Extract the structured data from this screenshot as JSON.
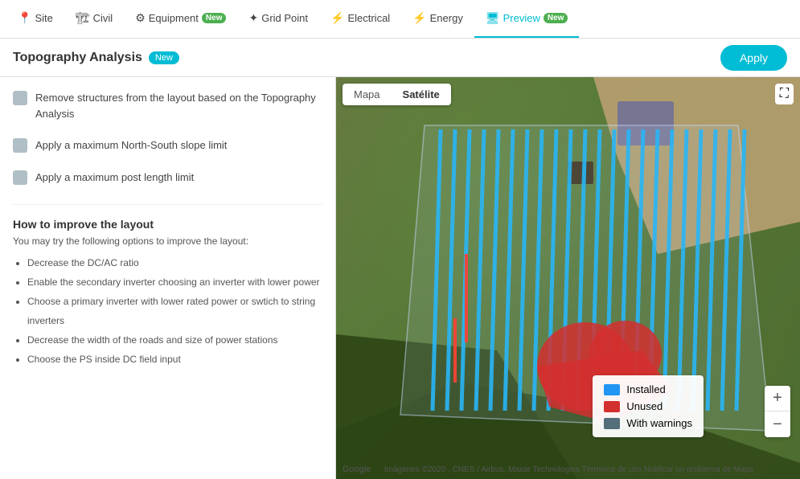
{
  "nav": {
    "items": [
      {
        "id": "site",
        "label": "Site",
        "icon": "📍",
        "badge": null,
        "active": false
      },
      {
        "id": "civil",
        "label": "Civil",
        "icon": "🏗",
        "badge": null,
        "active": false
      },
      {
        "id": "equipment",
        "label": "Equipment",
        "icon": "⚙",
        "badge": "New",
        "active": false
      },
      {
        "id": "gridpoint",
        "label": "Grid Point",
        "icon": "✦",
        "badge": null,
        "active": false
      },
      {
        "id": "electrical",
        "label": "Electrical",
        "icon": "⚡",
        "badge": null,
        "active": false
      },
      {
        "id": "energy",
        "label": "Energy",
        "icon": "⚡",
        "badge": null,
        "active": false
      },
      {
        "id": "preview",
        "label": "Preview",
        "icon": "🖥",
        "badge": "New",
        "active": true
      }
    ]
  },
  "subheader": {
    "title": "Topography Analysis",
    "badge": "New",
    "apply_label": "Apply"
  },
  "left_panel": {
    "toggles": [
      {
        "id": "toggle1",
        "text": "Remove structures from the layout based on the Topography Analysis"
      },
      {
        "id": "toggle2",
        "text": "Apply a maximum North-South slope limit"
      },
      {
        "id": "toggle3",
        "text": "Apply a maximum post length limit"
      }
    ],
    "improve": {
      "title": "How to improve the layout",
      "intro": "You may try the following options to improve the layout:",
      "items": [
        "Decrease the DC/AC ratio",
        "Enable the secondary inverter choosing an inverter with lower power",
        "Choose a primary inverter with lower rated power or swtich to string inverters",
        "Decrease the width of the roads and size of power stations",
        "Choose the PS inside DC field input"
      ]
    }
  },
  "map": {
    "tabs": [
      "Mapa",
      "Satélite"
    ],
    "active_tab": "Satélite",
    "legend": {
      "installed_label": "Installed",
      "unused_label": "Unused",
      "warnings_label": "With warnings",
      "installed_color": "#2196f3",
      "unused_color": "#d32f2f",
      "warnings_color": "#546e7a"
    },
    "zoom_plus": "+",
    "zoom_minus": "−",
    "google_label": "Google",
    "attribution": "Imágenes ©2020 , CNES / Airbus, Maxar Technologies   Términos de uso   Notificar un problema de Maps"
  }
}
